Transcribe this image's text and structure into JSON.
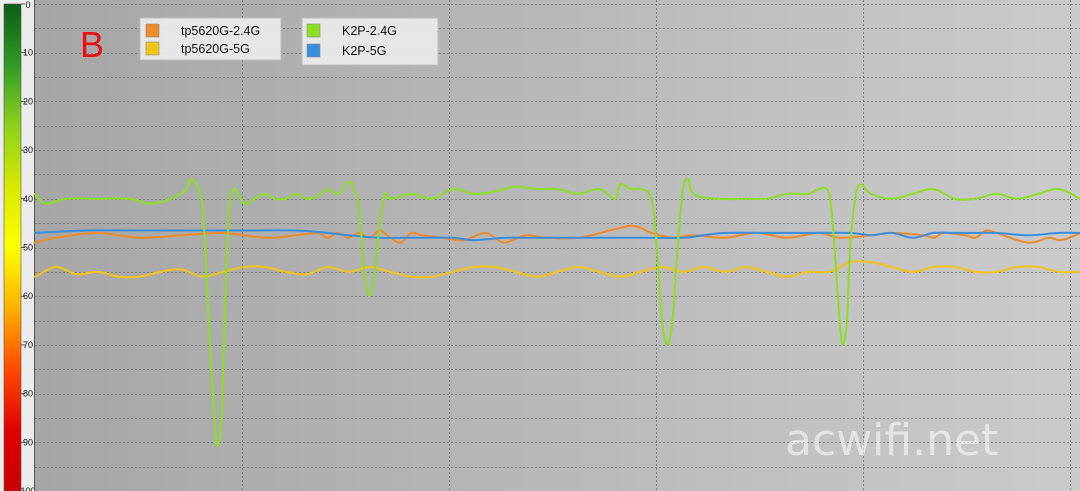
{
  "panel_letter": "B",
  "watermark": "acwifi.net",
  "chart_data": {
    "type": "line",
    "y_axis": {
      "ticks": [
        0,
        10,
        20,
        30,
        40,
        50,
        60,
        70,
        80,
        90,
        100
      ],
      "tick_labels": [
        "0",
        "10",
        "20",
        "30",
        "40",
        "50",
        "60",
        "70",
        "80",
        "90",
        "100"
      ],
      "ylim": [
        0,
        100
      ],
      "inverted": true,
      "color_scale": [
        "#0a5e14",
        "#2f9a24",
        "#8cd21c",
        "#d8e800",
        "#ffff00",
        "#ffb000",
        "#ff4a00",
        "#e00000",
        "#c80000"
      ]
    },
    "x_range": [
      0,
      1
    ],
    "grid": true,
    "background_gradient": [
      "#a6a6a6",
      "#cbcbcb"
    ],
    "legend": {
      "placement": "top-left",
      "columns": 2
    },
    "series": [
      {
        "name": "tp5620G-2.4G",
        "color": "#f08a28",
        "points": [
          [
            0,
            49
          ],
          [
            0.02,
            48
          ],
          [
            0.06,
            47
          ],
          [
            0.1,
            48
          ],
          [
            0.14,
            47.5
          ],
          [
            0.18,
            47
          ],
          [
            0.22,
            48
          ],
          [
            0.25,
            47.5
          ],
          [
            0.27,
            47
          ],
          [
            0.28,
            48
          ],
          [
            0.29,
            47
          ],
          [
            0.3,
            48
          ],
          [
            0.31,
            47
          ],
          [
            0.32,
            48
          ],
          [
            0.33,
            46.5
          ],
          [
            0.34,
            48
          ],
          [
            0.35,
            49
          ],
          [
            0.36,
            47
          ],
          [
            0.37,
            47.5
          ],
          [
            0.39,
            48
          ],
          [
            0.41,
            48.5
          ],
          [
            0.43,
            47
          ],
          [
            0.44,
            48
          ],
          [
            0.45,
            49
          ],
          [
            0.47,
            47.5
          ],
          [
            0.49,
            48
          ],
          [
            0.52,
            48
          ],
          [
            0.55,
            46.5
          ],
          [
            0.56,
            46
          ],
          [
            0.57,
            45.5
          ],
          [
            0.58,
            46
          ],
          [
            0.59,
            47
          ],
          [
            0.61,
            48
          ],
          [
            0.63,
            47.5
          ],
          [
            0.66,
            48
          ],
          [
            0.69,
            47
          ],
          [
            0.72,
            48
          ],
          [
            0.75,
            47
          ],
          [
            0.77,
            48
          ],
          [
            0.8,
            47.5
          ],
          [
            0.82,
            47
          ],
          [
            0.85,
            47.5
          ],
          [
            0.86,
            48
          ],
          [
            0.87,
            47
          ],
          [
            0.89,
            47.5
          ],
          [
            0.9,
            48
          ],
          [
            0.91,
            46.5
          ],
          [
            0.92,
            47
          ],
          [
            0.95,
            49
          ],
          [
            0.97,
            48
          ],
          [
            0.98,
            48.5
          ],
          [
            0.99,
            48
          ],
          [
            1,
            47
          ]
        ]
      },
      {
        "name": "tp5620G-5G",
        "color": "#f2c418",
        "points": [
          [
            0,
            56
          ],
          [
            0.02,
            54
          ],
          [
            0.04,
            55.5
          ],
          [
            0.06,
            55
          ],
          [
            0.08,
            56
          ],
          [
            0.1,
            56
          ],
          [
            0.12,
            55
          ],
          [
            0.14,
            54.5
          ],
          [
            0.16,
            56
          ],
          [
            0.18,
            55
          ],
          [
            0.2,
            54
          ],
          [
            0.22,
            54
          ],
          [
            0.24,
            55
          ],
          [
            0.26,
            55.5
          ],
          [
            0.28,
            54
          ],
          [
            0.3,
            55
          ],
          [
            0.32,
            54
          ],
          [
            0.34,
            55
          ],
          [
            0.36,
            56
          ],
          [
            0.38,
            56
          ],
          [
            0.4,
            55
          ],
          [
            0.42,
            54
          ],
          [
            0.44,
            54
          ],
          [
            0.46,
            55
          ],
          [
            0.48,
            56
          ],
          [
            0.5,
            55
          ],
          [
            0.52,
            54
          ],
          [
            0.54,
            55
          ],
          [
            0.56,
            56
          ],
          [
            0.58,
            55
          ],
          [
            0.6,
            54
          ],
          [
            0.62,
            55
          ],
          [
            0.64,
            54
          ],
          [
            0.66,
            55
          ],
          [
            0.68,
            54
          ],
          [
            0.7,
            55
          ],
          [
            0.72,
            56
          ],
          [
            0.74,
            55
          ],
          [
            0.76,
            55
          ],
          [
            0.78,
            53
          ],
          [
            0.8,
            53
          ],
          [
            0.82,
            54
          ],
          [
            0.84,
            55
          ],
          [
            0.86,
            54
          ],
          [
            0.88,
            54
          ],
          [
            0.9,
            55
          ],
          [
            0.92,
            55
          ],
          [
            0.94,
            54
          ],
          [
            0.96,
            54
          ],
          [
            0.98,
            55
          ],
          [
            1,
            55
          ]
        ]
      },
      {
        "name": "K2P-2.4G",
        "color": "#8ae020",
        "points": [
          [
            0,
            39
          ],
          [
            0.01,
            41
          ],
          [
            0.03,
            40
          ],
          [
            0.06,
            40
          ],
          [
            0.09,
            40
          ],
          [
            0.11,
            41
          ],
          [
            0.13,
            40
          ],
          [
            0.145,
            38
          ],
          [
            0.15,
            36
          ],
          [
            0.16,
            41
          ],
          [
            0.165,
            60
          ],
          [
            0.172,
            87
          ],
          [
            0.175,
            90.5
          ],
          [
            0.178,
            87
          ],
          [
            0.18,
            75
          ],
          [
            0.185,
            45
          ],
          [
            0.19,
            38
          ],
          [
            0.2,
            41
          ],
          [
            0.21,
            40
          ],
          [
            0.22,
            39
          ],
          [
            0.23,
            40
          ],
          [
            0.24,
            40
          ],
          [
            0.25,
            39
          ],
          [
            0.26,
            40
          ],
          [
            0.27,
            39.5
          ],
          [
            0.28,
            38
          ],
          [
            0.29,
            39
          ],
          [
            0.3,
            36.5
          ],
          [
            0.305,
            38
          ],
          [
            0.31,
            42
          ],
          [
            0.315,
            55
          ],
          [
            0.32,
            60
          ],
          [
            0.325,
            55
          ],
          [
            0.33,
            45
          ],
          [
            0.335,
            39
          ],
          [
            0.34,
            40
          ],
          [
            0.36,
            39
          ],
          [
            0.38,
            40
          ],
          [
            0.4,
            38
          ],
          [
            0.42,
            39
          ],
          [
            0.44,
            38.5
          ],
          [
            0.46,
            37.5
          ],
          [
            0.48,
            38
          ],
          [
            0.5,
            38
          ],
          [
            0.52,
            39
          ],
          [
            0.54,
            38
          ],
          [
            0.555,
            40
          ],
          [
            0.56,
            37
          ],
          [
            0.57,
            38
          ],
          [
            0.58,
            38
          ],
          [
            0.59,
            40
          ],
          [
            0.595,
            50
          ],
          [
            0.6,
            65
          ],
          [
            0.605,
            70
          ],
          [
            0.61,
            65
          ],
          [
            0.615,
            50
          ],
          [
            0.62,
            38
          ],
          [
            0.625,
            36
          ],
          [
            0.63,
            39
          ],
          [
            0.65,
            40
          ],
          [
            0.68,
            40
          ],
          [
            0.7,
            40
          ],
          [
            0.72,
            39
          ],
          [
            0.74,
            39
          ],
          [
            0.75,
            38
          ],
          [
            0.76,
            39
          ],
          [
            0.765,
            50
          ],
          [
            0.77,
            65
          ],
          [
            0.773,
            70
          ],
          [
            0.777,
            65
          ],
          [
            0.78,
            50
          ],
          [
            0.785,
            40
          ],
          [
            0.79,
            37
          ],
          [
            0.8,
            39
          ],
          [
            0.82,
            40
          ],
          [
            0.84,
            39
          ],
          [
            0.86,
            38
          ],
          [
            0.88,
            40
          ],
          [
            0.9,
            40
          ],
          [
            0.92,
            39
          ],
          [
            0.94,
            40
          ],
          [
            0.96,
            39
          ],
          [
            0.98,
            38
          ],
          [
            1,
            40
          ]
        ]
      },
      {
        "name": "K2P-5G",
        "color": "#3a8ee0",
        "points": [
          [
            0,
            47
          ],
          [
            0.05,
            46.5
          ],
          [
            0.1,
            46.5
          ],
          [
            0.15,
            46.5
          ],
          [
            0.2,
            46.5
          ],
          [
            0.25,
            46.5
          ],
          [
            0.28,
            47
          ],
          [
            0.3,
            47.5
          ],
          [
            0.33,
            48
          ],
          [
            0.36,
            48
          ],
          [
            0.4,
            48
          ],
          [
            0.42,
            48.5
          ],
          [
            0.45,
            48
          ],
          [
            0.48,
            48
          ],
          [
            0.52,
            48
          ],
          [
            0.55,
            48
          ],
          [
            0.58,
            48
          ],
          [
            0.62,
            48
          ],
          [
            0.64,
            47.5
          ],
          [
            0.66,
            47
          ],
          [
            0.7,
            47
          ],
          [
            0.74,
            47
          ],
          [
            0.78,
            47
          ],
          [
            0.8,
            47.5
          ],
          [
            0.82,
            47
          ],
          [
            0.84,
            48
          ],
          [
            0.86,
            47
          ],
          [
            0.88,
            47
          ],
          [
            0.9,
            47
          ],
          [
            0.92,
            47
          ],
          [
            0.95,
            47.5
          ],
          [
            0.98,
            47
          ],
          [
            1,
            47
          ]
        ]
      }
    ]
  }
}
